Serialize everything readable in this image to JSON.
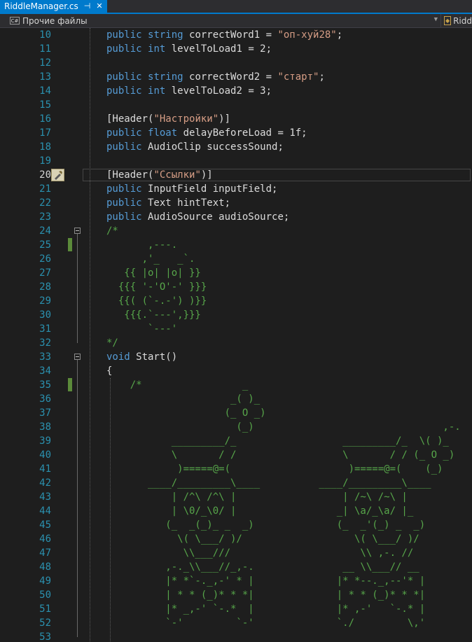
{
  "tab": {
    "title": "RiddleManager.cs",
    "pin_icon": "pin-icon",
    "close_icon": "close-icon"
  },
  "navbar": {
    "project_icon": "csharp-project-icon",
    "project_icon_text": "C#",
    "project_label": "Прочие файлы",
    "class_icon": "class-icon",
    "class_label": "Ridd"
  },
  "editor": {
    "current_line": 20,
    "colors": {
      "keyword": "#569cd6",
      "string": "#d69d85",
      "comment": "#57a64a",
      "line_number": "#2b91af",
      "change_mark": "#5b8a3a"
    },
    "lines": [
      {
        "n": "10",
        "tokens": [
          [
            "kw",
            "public"
          ],
          [
            "ty",
            " "
          ],
          [
            "kw",
            "string"
          ],
          [
            "ty",
            " correctWord1 = "
          ],
          [
            "str",
            "\"оп-хуй28\""
          ],
          [
            "ty",
            ";"
          ]
        ]
      },
      {
        "n": "11",
        "tokens": [
          [
            "kw",
            "public"
          ],
          [
            "ty",
            " "
          ],
          [
            "kw",
            "int"
          ],
          [
            "ty",
            " levelToLoad1 = 2;"
          ]
        ]
      },
      {
        "n": "12",
        "tokens": []
      },
      {
        "n": "13",
        "tokens": [
          [
            "kw",
            "public"
          ],
          [
            "ty",
            " "
          ],
          [
            "kw",
            "string"
          ],
          [
            "ty",
            " correctWord2 = "
          ],
          [
            "str",
            "\"старт\""
          ],
          [
            "ty",
            ";"
          ]
        ]
      },
      {
        "n": "14",
        "tokens": [
          [
            "kw",
            "public"
          ],
          [
            "ty",
            " "
          ],
          [
            "kw",
            "int"
          ],
          [
            "ty",
            " levelToLoad2 = 3;"
          ]
        ]
      },
      {
        "n": "15",
        "tokens": []
      },
      {
        "n": "16",
        "tokens": [
          [
            "ty",
            "[Header("
          ],
          [
            "str",
            "\"Настройки\""
          ],
          [
            "ty",
            ")]"
          ]
        ]
      },
      {
        "n": "17",
        "tokens": [
          [
            "kw",
            "public"
          ],
          [
            "ty",
            " "
          ],
          [
            "kw",
            "float"
          ],
          [
            "ty",
            " delayBeforeLoad = 1f;"
          ]
        ]
      },
      {
        "n": "18",
        "tokens": [
          [
            "kw",
            "public"
          ],
          [
            "ty",
            " AudioClip successSound;"
          ]
        ]
      },
      {
        "n": "19",
        "tokens": []
      },
      {
        "n": "20",
        "tokens": [
          [
            "ty",
            "[Header("
          ],
          [
            "str",
            "\"Ссылки\""
          ],
          [
            "ty",
            ")]"
          ]
        ]
      },
      {
        "n": "21",
        "tokens": [
          [
            "kw",
            "public"
          ],
          [
            "ty",
            " InputField inputField;"
          ]
        ]
      },
      {
        "n": "22",
        "tokens": [
          [
            "kw",
            "public"
          ],
          [
            "ty",
            " Text hintText;"
          ]
        ]
      },
      {
        "n": "23",
        "tokens": [
          [
            "kw",
            "public"
          ],
          [
            "ty",
            " AudioSource audioSource;"
          ]
        ]
      },
      {
        "n": "24",
        "tokens": [
          [
            "cm",
            "/*"
          ]
        ]
      },
      {
        "n": "25",
        "tokens": [
          [
            "cm",
            "       ,---."
          ]
        ]
      },
      {
        "n": "26",
        "tokens": [
          [
            "cm",
            "      ,'_   _`."
          ]
        ]
      },
      {
        "n": "27",
        "tokens": [
          [
            "cm",
            "   {{ |o| |o| }}"
          ]
        ]
      },
      {
        "n": "28",
        "tokens": [
          [
            "cm",
            "  {{{ '-'O'-' }}}"
          ]
        ]
      },
      {
        "n": "29",
        "tokens": [
          [
            "cm",
            "  {{( (`-.-') )}}"
          ]
        ]
      },
      {
        "n": "30",
        "tokens": [
          [
            "cm",
            "   {{{.`---',}}}"
          ]
        ]
      },
      {
        "n": "31",
        "tokens": [
          [
            "cm",
            "       `---'"
          ]
        ]
      },
      {
        "n": "32",
        "tokens": [
          [
            "cm",
            "*/"
          ]
        ]
      },
      {
        "n": "33",
        "tokens": [
          [
            "kw",
            "void"
          ],
          [
            "ty",
            " Start()"
          ]
        ]
      },
      {
        "n": "34",
        "tokens": [
          [
            "ty",
            "{"
          ]
        ]
      },
      {
        "n": "35",
        "tokens": [
          [
            "cm",
            "    /*                 _"
          ]
        ]
      },
      {
        "n": "36",
        "tokens": [
          [
            "cm",
            "                     _( )_"
          ]
        ]
      },
      {
        "n": "37",
        "tokens": [
          [
            "cm",
            "                    (_ O _)"
          ]
        ]
      },
      {
        "n": "38",
        "tokens": [
          [
            "cm",
            "                      (_)                                ,-.  _"
          ]
        ]
      },
      {
        "n": "39",
        "tokens": [
          [
            "cm",
            "           _________/_                  _________/_  \\( )_"
          ]
        ]
      },
      {
        "n": "40",
        "tokens": [
          [
            "cm",
            "           \\       / /                  \\       / / (_ O _)"
          ]
        ]
      },
      {
        "n": "41",
        "tokens": [
          [
            "cm",
            "            )=====@=(                    )=====@=(    (_)"
          ]
        ]
      },
      {
        "n": "42",
        "tokens": [
          [
            "cm",
            "       ____/_________\\____          ____/_________\\____"
          ]
        ]
      },
      {
        "n": "43",
        "tokens": [
          [
            "cm",
            "           | /^\\ /^\\ |                  | /~\\ /~\\ |"
          ]
        ]
      },
      {
        "n": "44",
        "tokens": [
          [
            "cm",
            "           | \\0/_\\0/ |                 _| \\a/_\\a/ |_"
          ]
        ]
      },
      {
        "n": "45",
        "tokens": [
          [
            "cm",
            "          (_  _(_)_ _  _)              (_  _'(_) _  _)"
          ]
        ]
      },
      {
        "n": "46",
        "tokens": [
          [
            "cm",
            "            \\( \\___/ )/                   \\( \\___/ )/"
          ]
        ]
      },
      {
        "n": "47",
        "tokens": [
          [
            "cm",
            "             \\\\___///                      \\\\ ,-. //"
          ]
        ]
      },
      {
        "n": "48",
        "tokens": [
          [
            "cm",
            "          ,-._\\\\___//_,-.               __ \\\\___// __"
          ]
        ]
      },
      {
        "n": "49",
        "tokens": [
          [
            "cm",
            "          |* *`-._,-' * |              |* *--._,--'* |"
          ]
        ]
      },
      {
        "n": "50",
        "tokens": [
          [
            "cm",
            "          | * * (_)* * *|              | * * (_)* * *|"
          ]
        ]
      },
      {
        "n": "51",
        "tokens": [
          [
            "cm",
            "          |* _,-' `-.*  |              |* ,-'   `-.* |"
          ]
        ]
      },
      {
        "n": "52",
        "tokens": [
          [
            "cm",
            "          `-'         `-'              `./         \\,'"
          ]
        ]
      },
      {
        "n": "53",
        "tokens": []
      }
    ]
  }
}
